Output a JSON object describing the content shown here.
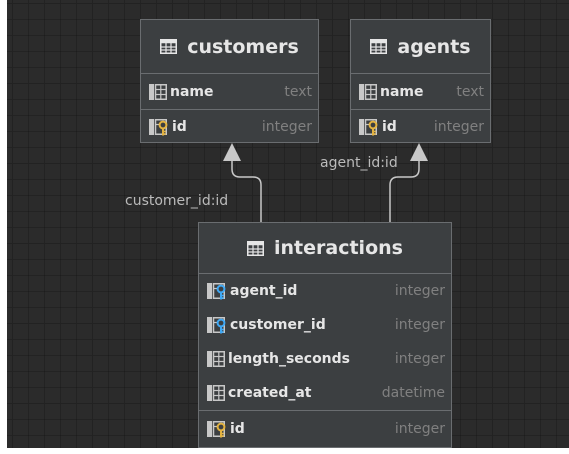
{
  "tables": [
    {
      "name": "customers",
      "columns": [
        {
          "name": "name",
          "type": "text",
          "icon": "column-icon"
        }
      ],
      "keys": [
        {
          "name": "id",
          "type": "integer",
          "icon": "primary-key-icon"
        }
      ]
    },
    {
      "name": "agents",
      "columns": [
        {
          "name": "name",
          "type": "text",
          "icon": "column-icon"
        }
      ],
      "keys": [
        {
          "name": "id",
          "type": "integer",
          "icon": "primary-key-icon"
        }
      ]
    },
    {
      "name": "interactions",
      "columns": [
        {
          "name": "agent_id",
          "type": "integer",
          "icon": "foreign-key-icon"
        },
        {
          "name": "customer_id",
          "type": "integer",
          "icon": "foreign-key-icon"
        },
        {
          "name": "length_seconds",
          "type": "integer",
          "icon": "column-icon"
        },
        {
          "name": "created_at",
          "type": "datetime",
          "icon": "column-icon"
        }
      ],
      "keys": [
        {
          "name": "id",
          "type": "integer",
          "icon": "primary-key-icon"
        }
      ]
    }
  ],
  "relations": [
    {
      "label": "customer_id:id"
    },
    {
      "label": "agent_id:id"
    }
  ],
  "colors": {
    "canvas_bg": "#2b2b2b",
    "table_bg": "#3c3f41",
    "table_border": "#6a6d70",
    "text_primary": "#e6e6e6",
    "text_type": "#808080",
    "connector": "#c8c8c8",
    "pk_key": "#e3b341",
    "fk_key": "#3fa9f5"
  }
}
